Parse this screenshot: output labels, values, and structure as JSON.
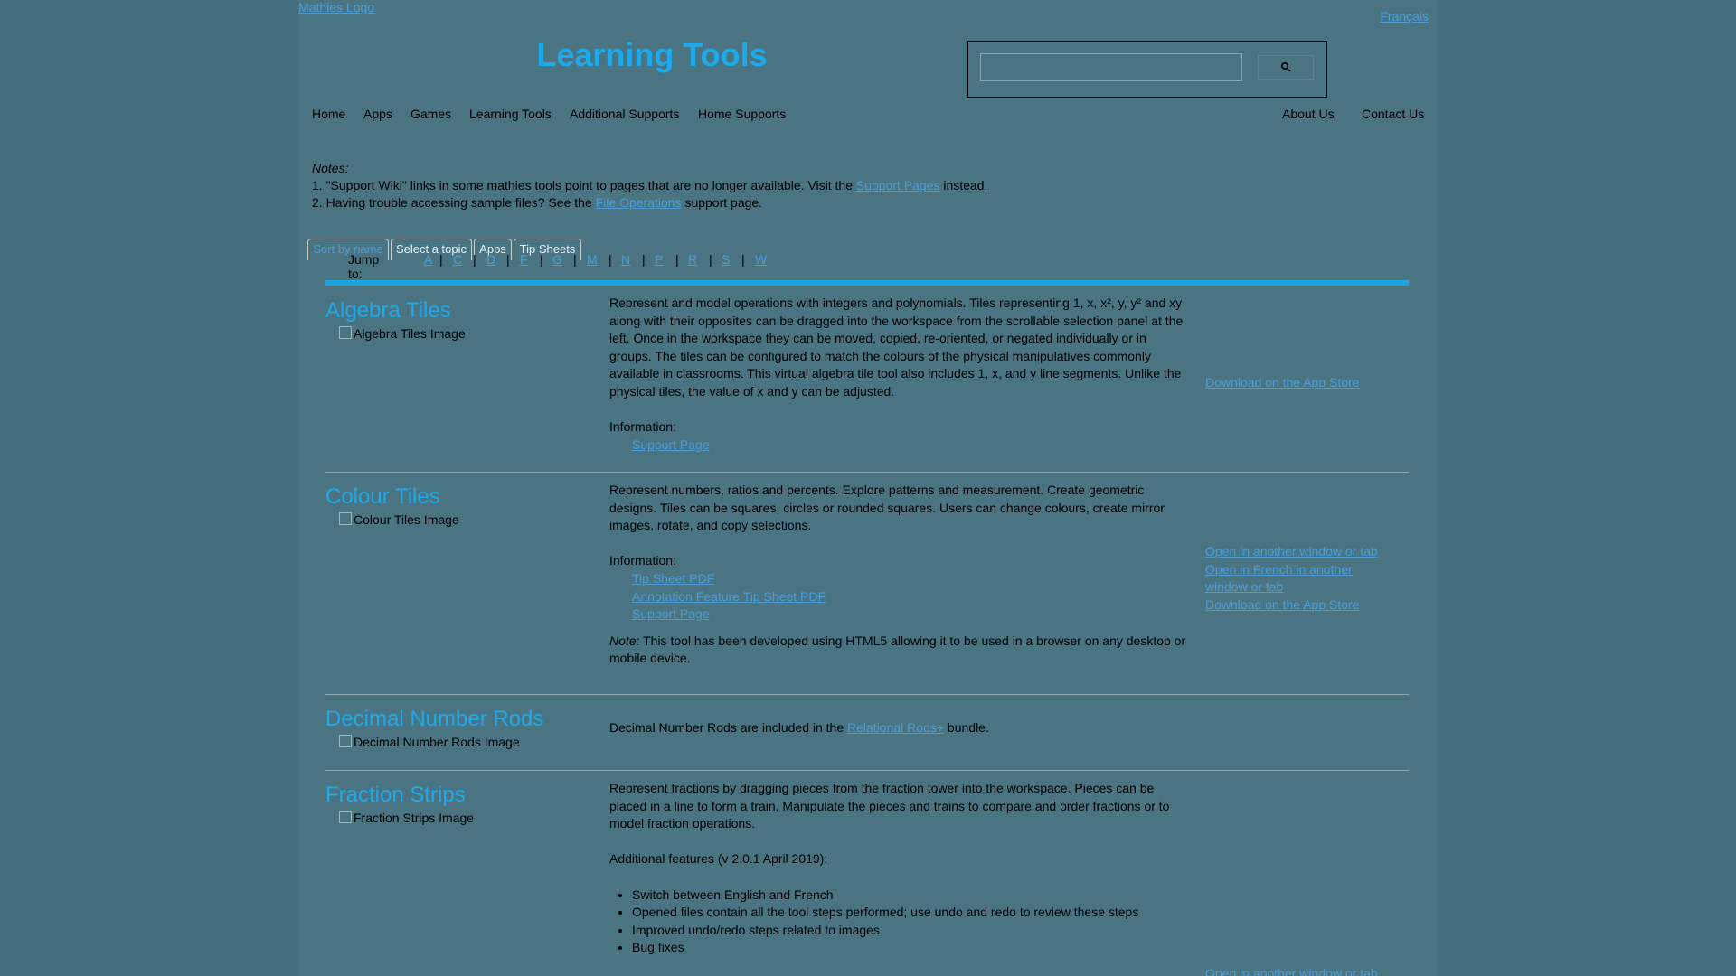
{
  "header": {
    "logo_alt": "Mathies Logo",
    "title": "Learning Tools",
    "lang_alt": "Français",
    "search": {
      "value": "",
      "button_icon": "search-icon"
    }
  },
  "nav": {
    "left": [
      "Home",
      "Apps",
      "Games",
      "Learning Tools",
      "Additional Supports",
      "Home Supports"
    ],
    "right": [
      "About Us",
      "Contact Us"
    ]
  },
  "notes": {
    "title": "Notes:",
    "line1_pre": "1. \"Support Wiki\" links in some mathies tools point to pages that are no longer available. Visit the ",
    "line1_link": "Support Pages",
    "line1_post": " instead.",
    "line2_pre": "2. Having trouble accessing sample files? See the ",
    "line2_link": "File Operations",
    "line2_post": " support page."
  },
  "tabs": [
    "Sort by name",
    "Select a topic",
    "Apps",
    "Tip Sheets"
  ],
  "jump": {
    "label": "Jump to:",
    "letters": [
      "A",
      "C",
      "D",
      "F",
      "G",
      "M",
      "N",
      "P",
      "R",
      "S",
      "W"
    ]
  },
  "tools": {
    "algebra": {
      "name": "Algebra Tiles",
      "image_alt": "Algebra Tiles Image",
      "desc": "Represent and model operations with integers and polynomials. Tiles representing 1, x, x², y, y² and xy along with their opposites can be dragged into the workspace from the scrollable selection panel at the left. Once in the workspace they can be moved, copied, re-oriented, or negated individually or in groups. The tiles can be configured to match the colours of the physical manipulatives commonly available in classrooms. This virtual algebra tile tool also includes 1, x, and y line segments. Unlike the physical tiles, the value of x and y can be adjusted.",
      "info_label": "Information:",
      "links": [
        "Support Page"
      ],
      "side": [
        "Download on the App Store"
      ]
    },
    "colour": {
      "name": "Colour Tiles",
      "image_alt": "Colour Tiles Image",
      "desc": "Represent numbers, ratios and percents. Explore patterns and measurement. Create geometric designs. Tiles can be squares, circles or rounded squares. Users can change colours, create mirror images, rotate, and copy selections.",
      "info_label": "Information:",
      "links": [
        "Tip Sheet PDF",
        "Annotation Feature Tip Sheet PDF",
        "Support Page"
      ],
      "note_label": "Note:",
      "note": " This tool has been developed using HTML5 allowing it to be used in a browser on any desktop or mobile device.",
      "side": [
        "Open in another window or tab",
        "Open in French in another window or tab",
        "Download on the App Store"
      ]
    },
    "decimal": {
      "name": "Decimal Number Rods",
      "image_alt": "Decimal Number Rods Image",
      "desc_pre": "Decimal Number Rods are included in the ",
      "desc_link": "Relational Rods+",
      "desc_post": " bundle."
    },
    "fraction": {
      "name": "Fraction Strips",
      "image_alt": "Fraction Strips Image",
      "desc": "Represent fractions by dragging pieces from the fraction tower into the workspace. Pieces can be placed in a line to form a train. Manipulate the pieces and trains to compare and order fractions or to model fraction operations.",
      "features_label": "Additional features (v 2.0.1 April 2019):",
      "features": [
        "Switch between English and French",
        "Opened files contain all the tool steps performed; use undo and redo to review these steps",
        "Improved undo/redo steps related to images",
        "Bug fixes"
      ],
      "side": [
        "Open in another window or tab"
      ]
    }
  },
  "colors": {
    "background": "#456f7f",
    "page": "#4b7483",
    "accent": "#1eaaea",
    "link": "#4a9ed8"
  }
}
